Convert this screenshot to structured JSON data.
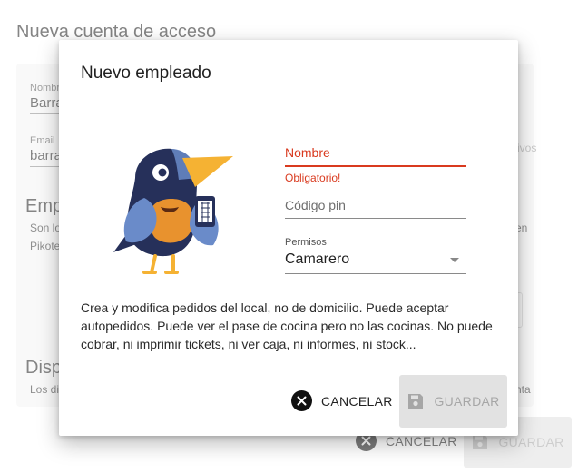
{
  "page": {
    "title": "Nueva cuenta de acceso",
    "name_label": "Nombr",
    "name_value": "Barra",
    "email_label": "Email",
    "email_value": "barra",
    "section1_heading": "Emp",
    "section1_text1": "Son lo",
    "section1_text2": "Pikote",
    "side_text1": "ivos",
    "side_text2": "en",
    "section2_heading": "Disp",
    "section2_text": "Los di",
    "side_text3": "nta",
    "cancel_label": "CANCELAR",
    "save_label": "GUARDAR"
  },
  "dialog": {
    "title": "Nuevo empleado",
    "name_placeholder": "Nombre",
    "name_error": "Obligatorio!",
    "pin_placeholder": "Código pin",
    "perm_label": "Permisos",
    "perm_value": "Camarero",
    "description": "Crea y modifica pedidos del local, no de domicilio. Puede aceptar autopedidos. Puede ver el pase de cocina pero no las cocinas. No puede cobrar, ni imprimir tickets, ni ver caja, ni informes, ni stock...",
    "cancel_label": "CANCELAR",
    "save_label": "GUARDAR"
  },
  "colors": {
    "error": "#d93a1f",
    "bird_body": "#26305a",
    "bird_wing": "#6a8bc9",
    "bird_beak": "#f5b233",
    "bird_belly": "#e8922e"
  },
  "icons": [
    "cancel-x-icon",
    "save-disk-icon",
    "dropdown-caret-icon",
    "bird-illustration"
  ]
}
